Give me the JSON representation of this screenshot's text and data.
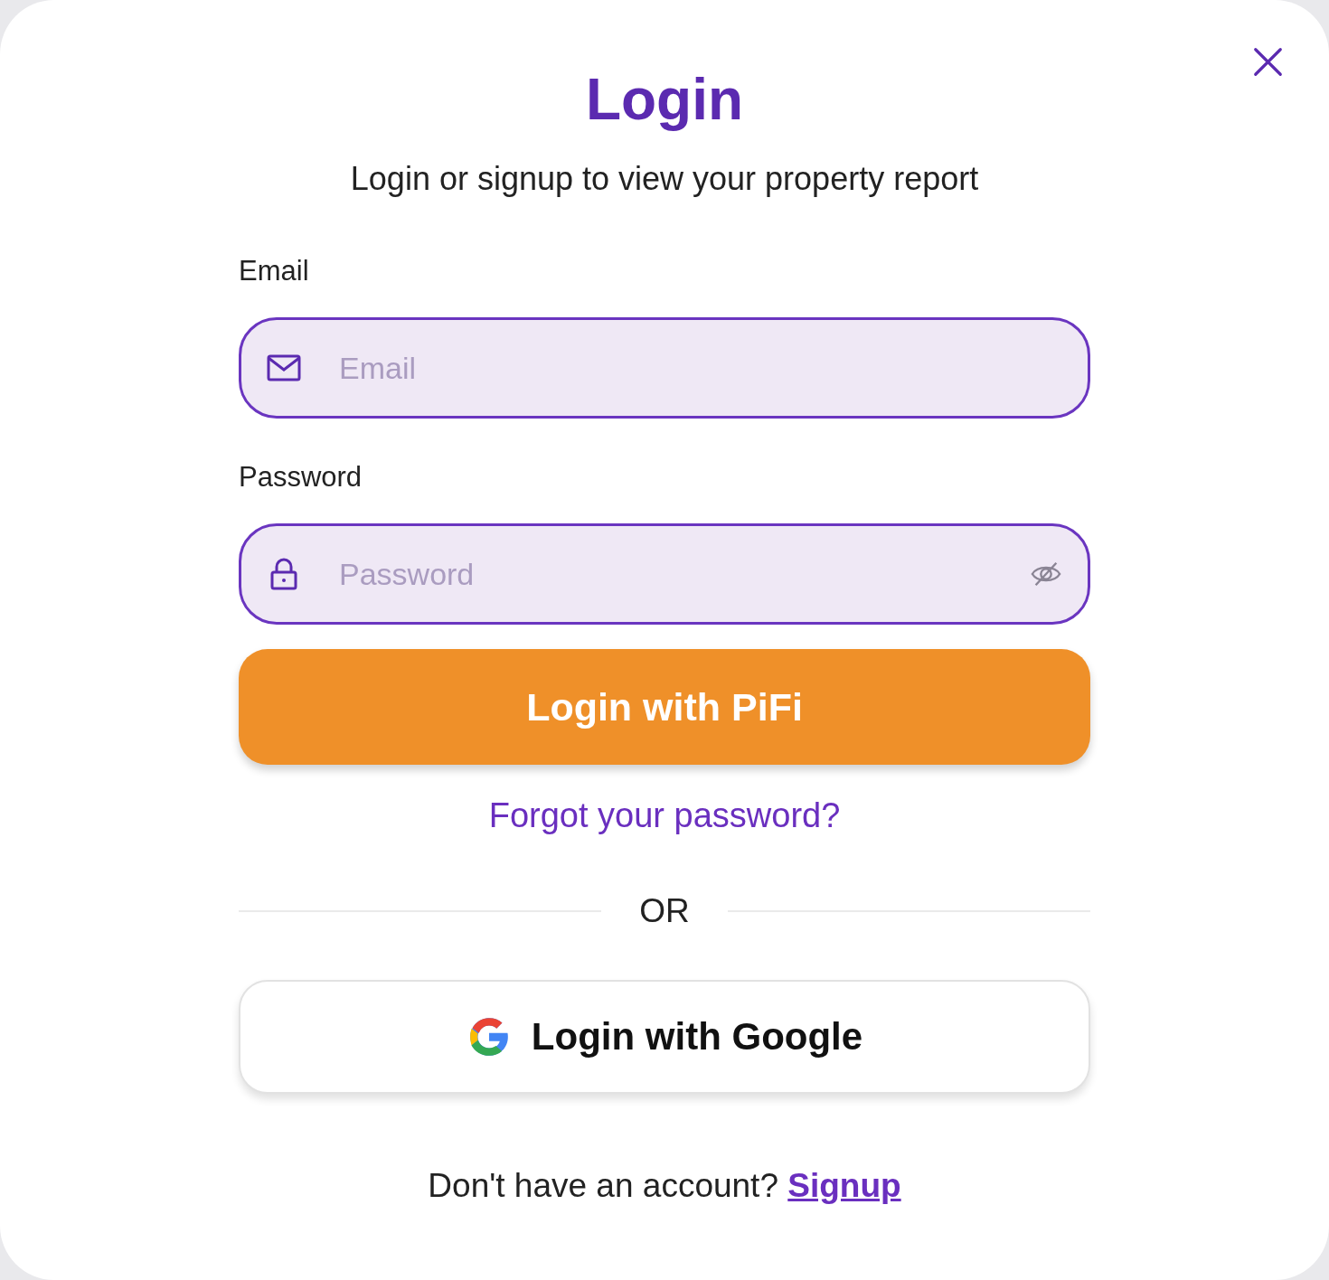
{
  "dialog": {
    "title": "Login",
    "subtitle": "Login or signup to view your property report"
  },
  "fields": [
    {
      "kind": "email",
      "label": "Email",
      "placeholder": "Email"
    },
    {
      "kind": "password",
      "label": "Password",
      "placeholder": "Password"
    }
  ],
  "primary_button": "Login with PiFi",
  "forgot_link": "Forgot your password?",
  "divider": "OR",
  "google_button": "Login with Google",
  "footer": {
    "text": "Don't have an account?",
    "link": "Signup"
  }
}
